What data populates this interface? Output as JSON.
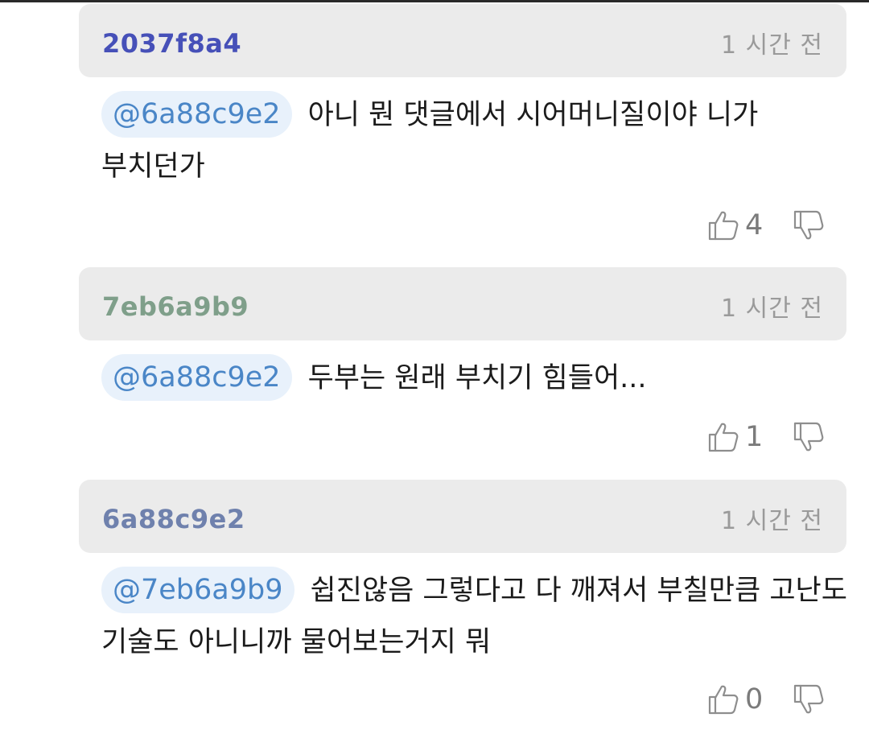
{
  "comments": [
    {
      "author": "2037f8a4",
      "author_color": "#4650b8",
      "time": "1 시간 전",
      "mention": "@6a88c9e2",
      "text": "아니 뭔 댓글에서 시어머니질이야 니가 부치던가",
      "likes": "4"
    },
    {
      "author": "7eb6a9b9",
      "author_color": "#7f9f8a",
      "time": "1 시간 전",
      "mention": "@6a88c9e2",
      "text": "두부는 원래 부치기 힘들어...",
      "likes": "1"
    },
    {
      "author": "6a88c9e2",
      "author_color": "#6f81ad",
      "time": "1 시간 전",
      "mention": "@7eb6a9b9",
      "text": "쉽진않음 그렇다고 다 깨져서 부칠만큼 고난도 기술도 아니니까 물어보는거지 뭐",
      "likes": "0"
    }
  ],
  "icons": {
    "like": "thumbs-up-icon",
    "dislike": "thumbs-down-icon"
  }
}
